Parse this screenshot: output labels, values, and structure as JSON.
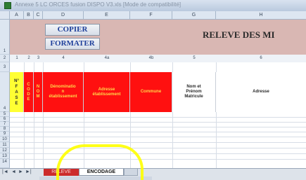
{
  "window": {
    "title": "Annexe 5 LC ORCES fusion DISPO V3.xls [Mode de compatibilité]"
  },
  "columns": [
    "A",
    "B",
    "C",
    "D",
    "E",
    "F",
    "G",
    "H"
  ],
  "rows": [
    "1",
    "2",
    "3",
    "4",
    "5",
    "6",
    "7",
    "8",
    "9",
    "10",
    "11",
    "12",
    "13",
    "14"
  ],
  "banner": {
    "copy_button": "COPIER",
    "format_button": "FORMATER",
    "title": "RELEVE DES MI"
  },
  "column_numbers": [
    "1",
    "2",
    "3",
    "4",
    "4a",
    "4b",
    "5",
    "6"
  ],
  "headers": {
    "nfase": "N°\nF\nA\nS\nE",
    "code": "C\nO\nD\nE",
    "nom_col": "N\nO\nM",
    "denomination": "Dénominatio\nn\nétablissement",
    "adresse_etab": "Adresse\nétablissement",
    "commune": "Commune",
    "nom_prenom": "Nom et\nPrénom\nMatricule",
    "adresse": "Adresse"
  },
  "tabs": {
    "sheet1": "RELEVE",
    "active": "ENCODAGE"
  }
}
